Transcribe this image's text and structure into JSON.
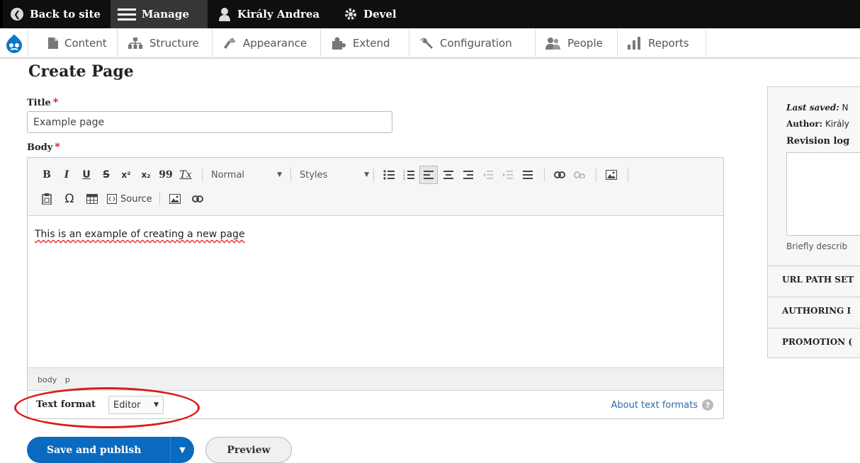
{
  "toolbar": {
    "back": "Back to site",
    "manage": "Manage",
    "user": "Király Andrea",
    "devel": "Devel"
  },
  "tray": {
    "items": [
      "Content",
      "Structure",
      "Appearance",
      "Extend",
      "Configuration",
      "People",
      "Reports"
    ]
  },
  "page": {
    "title": "Create Page",
    "title_label": "Title",
    "title_value": "Example page",
    "body_label": "Body",
    "required_mark": "*"
  },
  "editor": {
    "row1": [
      "B",
      "I",
      "U",
      "S",
      "x²",
      "x₂",
      "99",
      "Tx"
    ],
    "format_combo": "Normal",
    "styles_combo": "Styles",
    "source_label": "Source",
    "content": "This is an example of creating a new page",
    "path": [
      "body",
      "p"
    ],
    "text_format_label": "Text format",
    "text_format_value": "Editor",
    "about_link": "About text formats"
  },
  "actions": {
    "save": "Save and publish",
    "preview": "Preview"
  },
  "sidebar": {
    "last_saved_label": "Last saved:",
    "last_saved_value": "N",
    "author_label": "Author:",
    "author_value": "Király",
    "revision_log": "Revision log",
    "revision_desc": "Briefly describ",
    "sections": [
      "URL PATH SET",
      "AUTHORING I",
      "PROMOTION ("
    ]
  },
  "colors": {
    "accent": "#0a6ac0",
    "annotation": "#d81c1c",
    "toolbar_bg": "#0f0f0f"
  }
}
